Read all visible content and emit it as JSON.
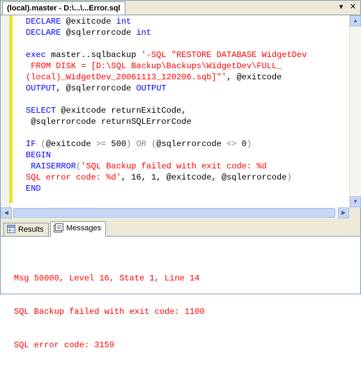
{
  "document_tab": {
    "title": "(local).master - D:\\...\\...Error.sql"
  },
  "tab_controls": {
    "dropdown": "▾",
    "close": "✕"
  },
  "colors": {
    "keyword": "#0000ff",
    "string": "#ff0000",
    "operator": "#808080",
    "message_text": "#ff0000",
    "modified_marker": "#f2e60a"
  },
  "code_lines": [
    [
      {
        "t": "DECLARE ",
        "c": "kw"
      },
      {
        "t": "@exitcode ",
        "c": ""
      },
      {
        "t": "int",
        "c": "kw"
      }
    ],
    [
      {
        "t": "DECLARE ",
        "c": "kw"
      },
      {
        "t": "@sqlerrorcode ",
        "c": ""
      },
      {
        "t": "int",
        "c": "kw"
      }
    ],
    [],
    [
      {
        "t": "exec ",
        "c": "kw"
      },
      {
        "t": "master..sqlbackup ",
        "c": ""
      },
      {
        "t": "'-SQL \"RESTORE DATABASE WidgetDev",
        "c": "str"
      }
    ],
    [
      {
        "t": " FROM DISK = [D:\\SQL Backup\\Backups\\WidgetDev\\FULL_",
        "c": "str"
      }
    ],
    [
      {
        "t": "(local)_WidgetDev_20061113_120206.sqb]\"'",
        "c": "str"
      },
      {
        "t": ", @exitcode",
        "c": ""
      }
    ],
    [
      {
        "t": "OUTPUT",
        "c": "kw"
      },
      {
        "t": ", @sqlerrorcode ",
        "c": ""
      },
      {
        "t": "OUTPUT",
        "c": "kw"
      }
    ],
    [],
    [
      {
        "t": "SELECT ",
        "c": "kw"
      },
      {
        "t": "@exitcode returnExitCode,",
        "c": ""
      }
    ],
    [
      {
        "t": " @sqlerrorcode returnSQLErrorCode",
        "c": ""
      }
    ],
    [],
    [
      {
        "t": "IF ",
        "c": "kw"
      },
      {
        "t": "(",
        "c": "op"
      },
      {
        "t": "@exitcode ",
        "c": ""
      },
      {
        "t": ">=",
        "c": "op"
      },
      {
        "t": " 500",
        "c": ""
      },
      {
        "t": ")",
        "c": "op"
      },
      {
        "t": " ",
        "c": ""
      },
      {
        "t": "OR",
        "c": "op"
      },
      {
        "t": " ",
        "c": ""
      },
      {
        "t": "(",
        "c": "op"
      },
      {
        "t": "@sqlerrorcode ",
        "c": ""
      },
      {
        "t": "<>",
        "c": "op"
      },
      {
        "t": " 0",
        "c": ""
      },
      {
        "t": ")",
        "c": "op"
      }
    ],
    [
      {
        "t": "BEGIN",
        "c": "kw"
      }
    ],
    [
      {
        "t": " RAISERROR",
        "c": "kw"
      },
      {
        "t": "(",
        "c": "op"
      },
      {
        "t": "'SQL Backup failed with exit code: %d",
        "c": "str"
      }
    ],
    [
      {
        "t": "SQL error code: %d'",
        "c": "str"
      },
      {
        "t": ", 16, 1, @exitcode, @sqlerrorcode",
        "c": ""
      },
      {
        "t": ")",
        "c": "op"
      }
    ],
    [
      {
        "t": "END",
        "c": "kw"
      }
    ]
  ],
  "results_tabs": [
    {
      "label": "Results",
      "icon": "grid-icon",
      "active": false
    },
    {
      "label": "Messages",
      "icon": "messages-icon",
      "active": true
    }
  ],
  "messages": [
    "Msg 50000, Level 16, State 1, Line 14",
    "SQL Backup failed with exit code: 1100",
    "SQL error code: 3159"
  ]
}
